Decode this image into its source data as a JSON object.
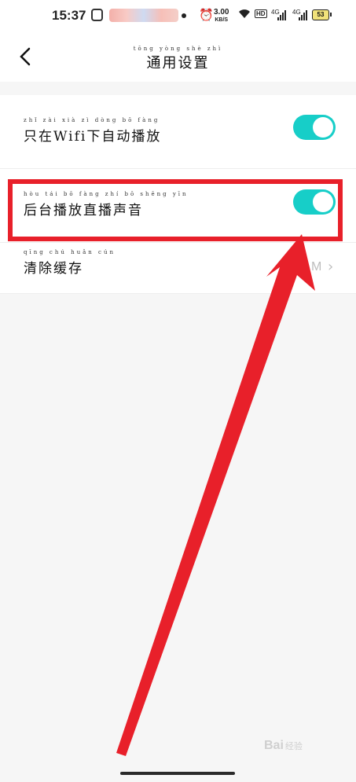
{
  "status_bar": {
    "time": "15:37",
    "speed_value": "3.00",
    "speed_unit": "KB/S",
    "hd_label": "HD",
    "signal_1_label": "4G",
    "signal_2_label": "4G",
    "battery_level": "53"
  },
  "header": {
    "title": "通用设置",
    "title_pinyin": "tōng yòng shè zhì",
    "back_icon": "chevron-left-icon"
  },
  "settings": {
    "wifi_autoplay": {
      "label": "只在Wifi下自动播放",
      "pinyin": "zhǐ zài        xià zì dòng bō fàng",
      "enabled": true
    },
    "background_audio": {
      "label": "后台播放直播声音",
      "pinyin": "hòu tái bō fàng zhí bō shēng yīn",
      "enabled": true
    },
    "clear_cache": {
      "label": "清除缓存",
      "pinyin": "qīng chú huǎn cún",
      "value": "M"
    }
  },
  "watermark": {
    "text": "Bai",
    "suffix": "经验"
  },
  "colors": {
    "toggle_on": "#17cec8",
    "annotation_red": "#e8202a"
  }
}
